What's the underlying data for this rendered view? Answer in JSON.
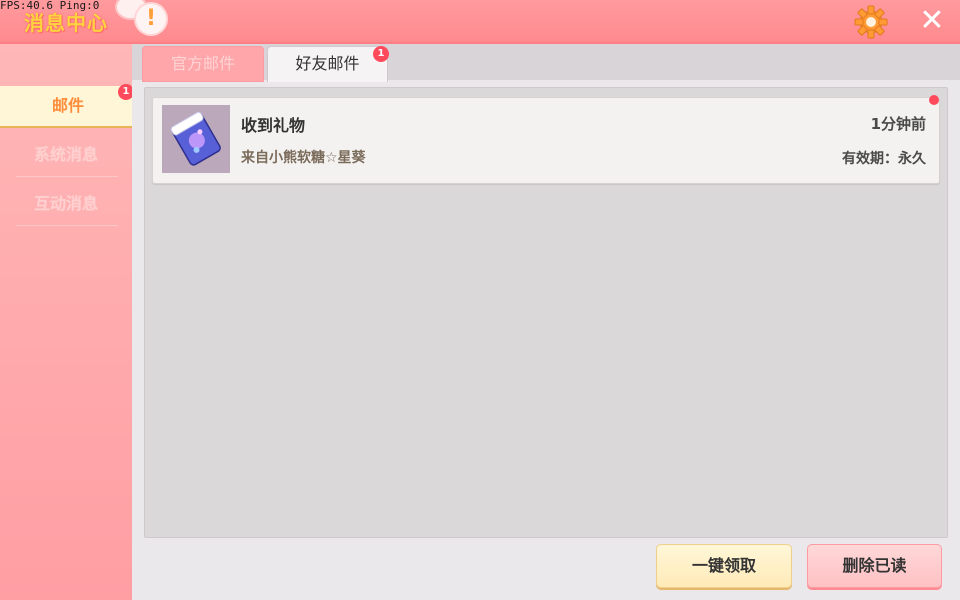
{
  "overlay": {
    "fps_text": "FPS:40.6  Ping:0"
  },
  "header": {
    "title": "消息中心",
    "alert_label": "!",
    "close_label": "✕"
  },
  "sidebar": {
    "items": [
      {
        "label": "邮件",
        "badge": "1"
      },
      {
        "label": "系统消息"
      },
      {
        "label": "互动消息"
      }
    ]
  },
  "tabs": [
    {
      "label": "官方邮件"
    },
    {
      "label": "好友邮件",
      "badge": "1"
    }
  ],
  "mail_list": [
    {
      "title": "收到礼物",
      "sender": "来自小熊软糖☆星葵",
      "time": "1分钟前",
      "expiry": "有效期：永久",
      "icon": "gift-card-icon"
    }
  ],
  "buttons": {
    "claim_all": "一键领取",
    "delete_read": "删除已读"
  },
  "colors": {
    "header": "#ff9a9e",
    "accent": "#ff8d3a",
    "badge": "#ff4a5c"
  }
}
